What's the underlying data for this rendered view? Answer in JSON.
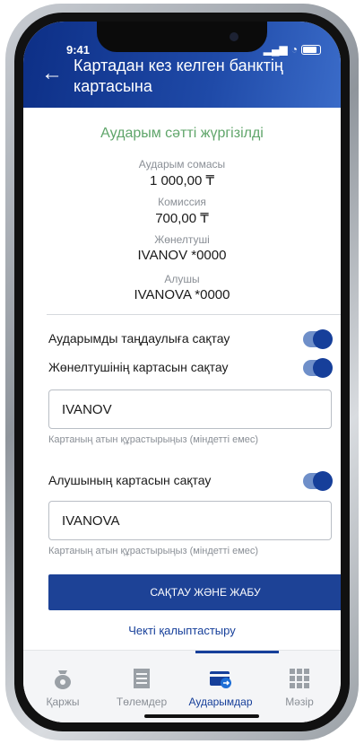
{
  "status": {
    "time": "9:41"
  },
  "header": {
    "title": "Картадан кез келген банктің картасына"
  },
  "result": {
    "success": "Аударым сәтті жүргізілді",
    "amount_label": "Аударым сомасы",
    "amount": "1 000,00 ₸",
    "commission_label": "Комиссия",
    "commission": "700,00 ₸",
    "sender_label": "Жөнелтуші",
    "sender": "IVANOV *0000",
    "receiver_label": "Алушы",
    "receiver": "IVANOVA *0000"
  },
  "options": {
    "save_favorite": "Аударымды таңдаулыға сақтау",
    "save_sender_card": "Жөнелтушінің картасын сақтау",
    "sender_card_name": "IVANOV",
    "sender_hint": "Картаның атын құрастырыңыз (міндетті емес)",
    "save_receiver_card": "Алушының картасын сақтау",
    "receiver_card_name": "IVANOVA",
    "receiver_hint": "Картаның атын құрастырыңыз (міндетті емес)"
  },
  "actions": {
    "save_close": "САҚТАУ ЖӘНЕ ЖАБУ",
    "receipt": "Чекті қалыптастыру"
  },
  "tabs": [
    {
      "label": "Қаржы",
      "icon": "money-bag-icon"
    },
    {
      "label": "Төлемдер",
      "icon": "payments-icon"
    },
    {
      "label": "Аударымдар",
      "icon": "transfer-card-icon"
    },
    {
      "label": "Мәзір",
      "icon": "menu-grid-icon"
    }
  ],
  "colors": {
    "accent": "#163f9a",
    "success": "#5fa56a"
  }
}
